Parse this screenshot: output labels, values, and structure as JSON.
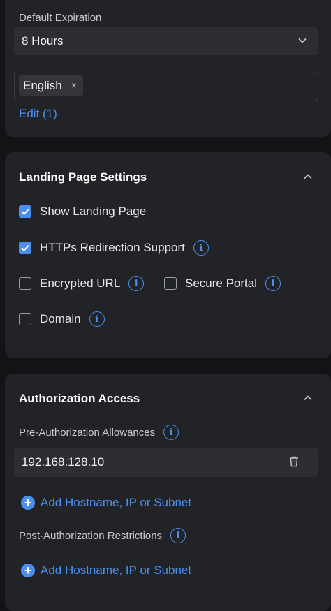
{
  "expiration": {
    "label": "Default Expiration",
    "value": "8 Hours"
  },
  "languages": {
    "tags": [
      "English"
    ],
    "remove_symbol": "×",
    "edit_link": "Edit (1)"
  },
  "landing": {
    "title": "Landing Page Settings",
    "options": [
      {
        "label": "Show Landing Page",
        "checked": true,
        "info": false
      },
      {
        "label": "HTTPs Redirection Support",
        "checked": true,
        "info": true
      },
      {
        "label": "Encrypted URL",
        "checked": false,
        "info": true
      },
      {
        "label": "Secure Portal",
        "checked": false,
        "info": true
      },
      {
        "label": "Domain",
        "checked": false,
        "info": true
      }
    ]
  },
  "auth": {
    "title": "Authorization Access",
    "pre_label": "Pre-Authorization Allowances",
    "pre_entries": [
      "192.168.128.10"
    ],
    "add_label": "Add Hostname, IP or Subnet",
    "post_label": "Post-Authorization Restrictions",
    "post_add_label": "Add Hostname, IP or Subnet"
  },
  "icons": {
    "info_glyph": "i",
    "plus_glyph": "+"
  },
  "colors": {
    "accent": "#4a8ff0",
    "card": "#222327",
    "background": "#131315"
  }
}
